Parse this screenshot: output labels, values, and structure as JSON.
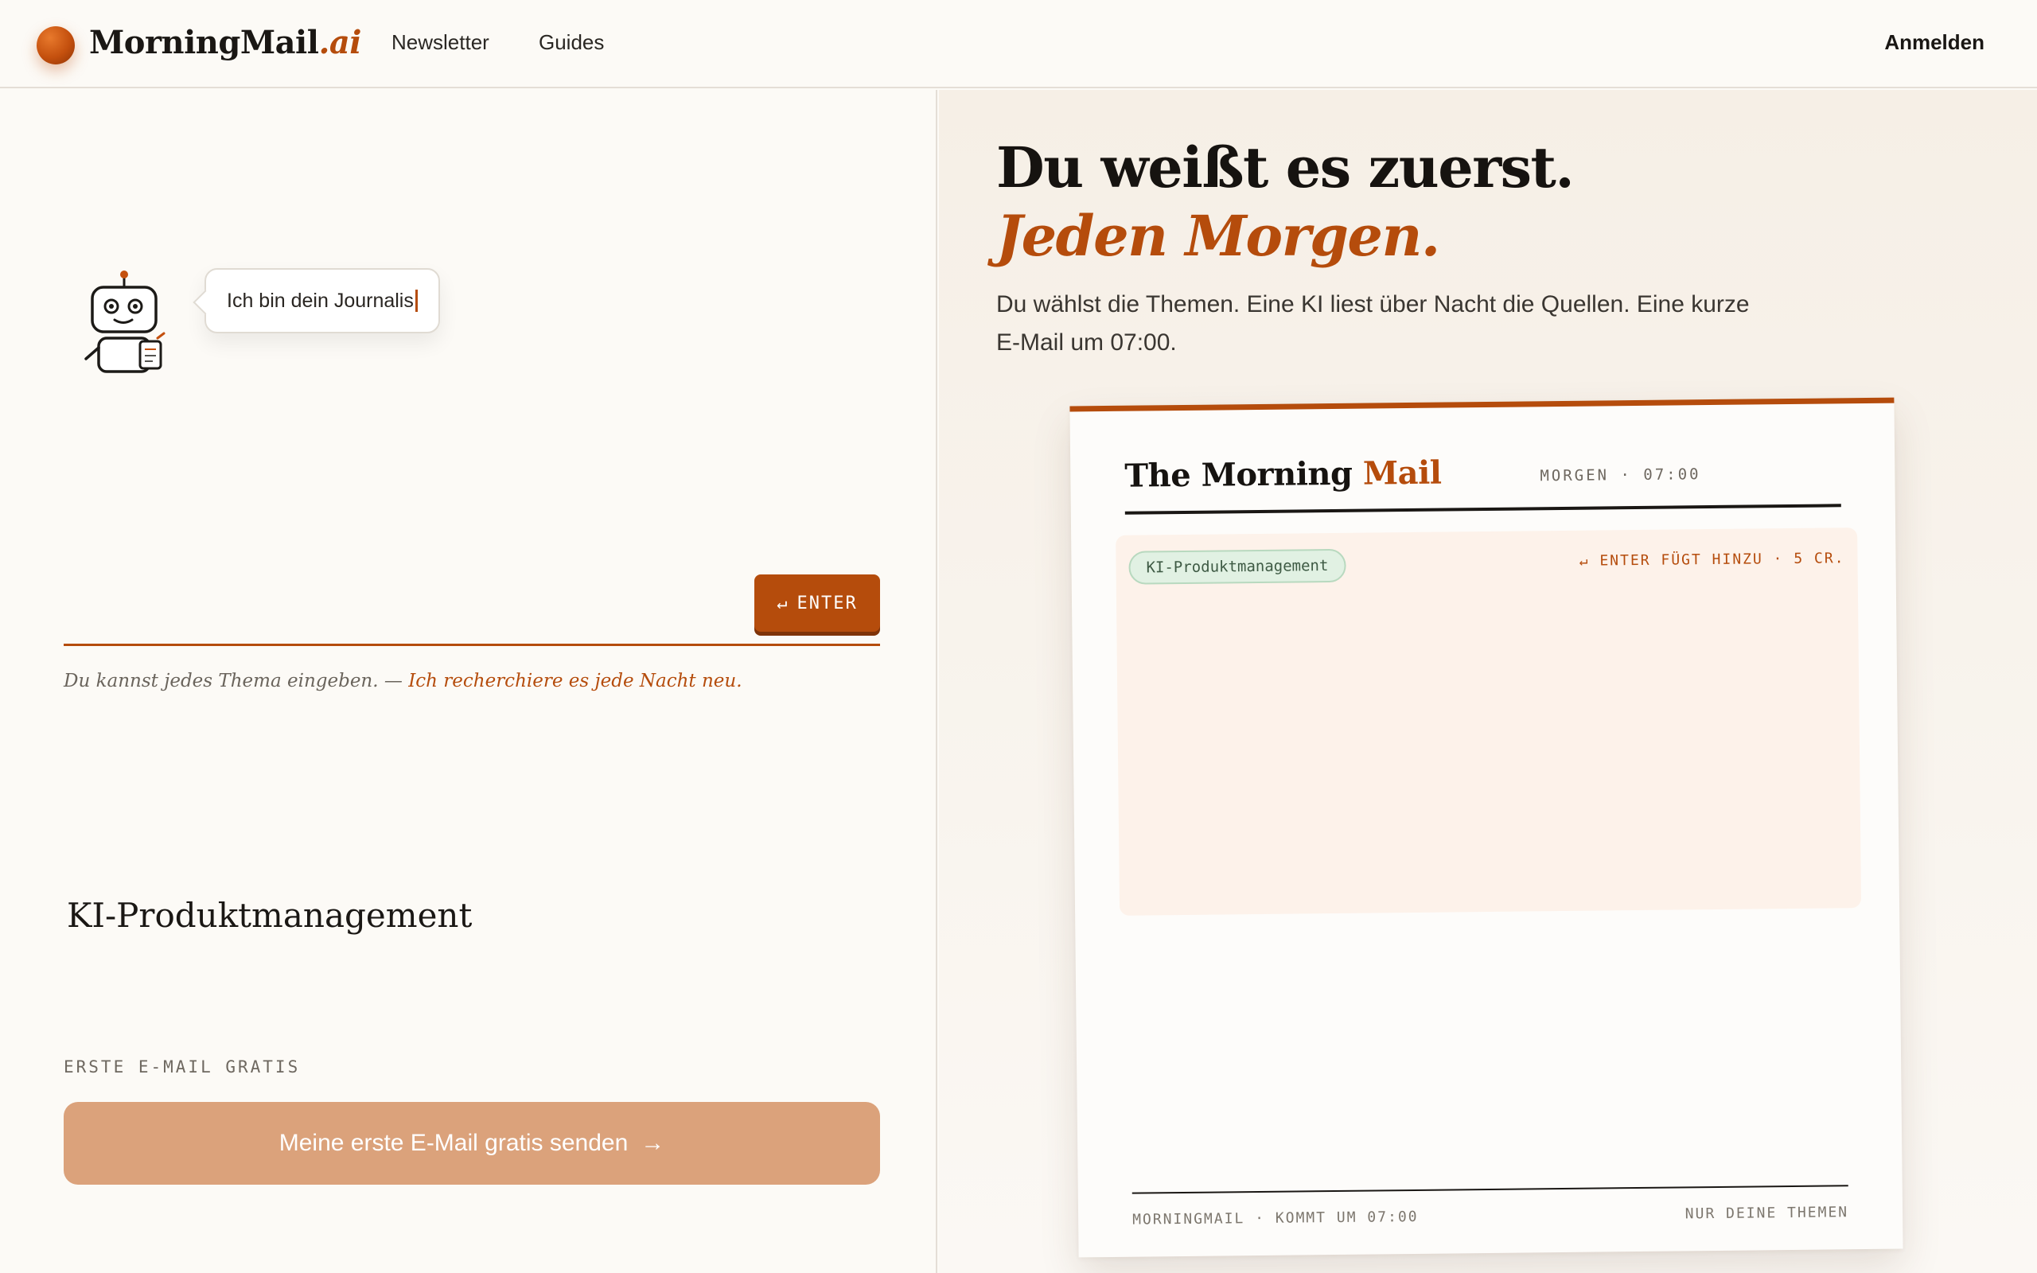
{
  "header": {
    "logo_main": "MorningMail",
    "logo_suffix": ".ai",
    "nav": [
      "Newsletter",
      "Guides"
    ],
    "login": "Anmelden"
  },
  "left": {
    "bubble_text": "Ich bin dein Journalis",
    "topic_value": "KI-Produktmanagement",
    "enter_symbol": "↵",
    "enter_label": "ENTER",
    "hint_prefix": "Du kannst jedes Thema eingeben. — ",
    "hint_accent": "Ich recherchiere es jede Nacht neu.",
    "free_label": "ERSTE E-MAIL GRATIS",
    "send_label": "Meine erste E-Mail gratis senden",
    "send_arrow": "→"
  },
  "right": {
    "headline": "Du weißt es zuerst.",
    "headline_accent": "Jeden Morgen.",
    "subtitle": "Du wählst die Themen. Eine KI liest über Nacht die Quellen. Eine kurze E-Mail um 07:00.",
    "mail": {
      "brand_main": "The Morning",
      "brand_accent": "Mail",
      "time": "MORGEN · 07:00",
      "chip": "KI-Produktmanagement",
      "chip_hint": "↵ ENTER FÜGT HINZU · 5 CR.",
      "footer_left": "MORNINGMAIL · KOMMT UM 07:00",
      "footer_right": "NUR DEINE THEMEN"
    }
  },
  "colors": {
    "accent": "#b54c0c",
    "background": "#fcfaf6",
    "send_button": "#dba27b",
    "chip_bg": "#e1f1e3"
  }
}
